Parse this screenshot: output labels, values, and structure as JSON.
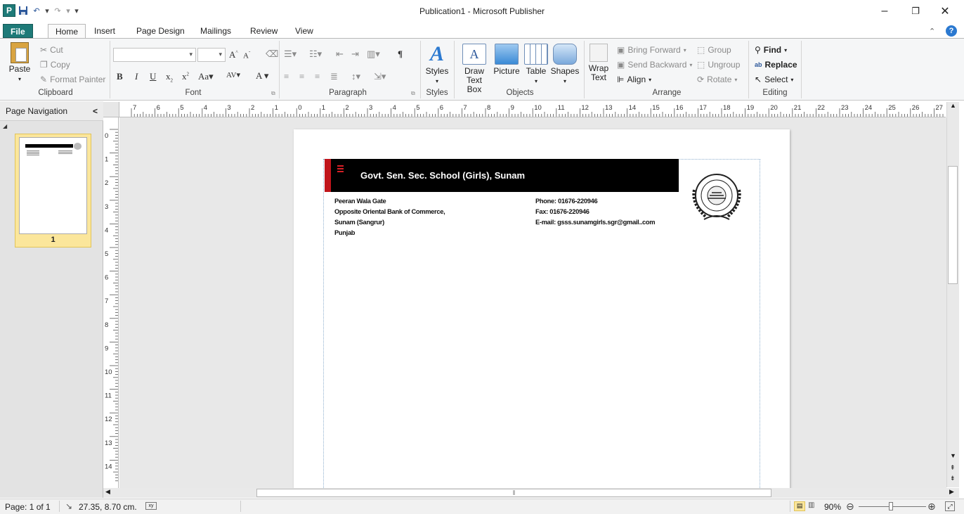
{
  "window": {
    "title": "Publication1 - Microsoft Publisher",
    "app_logo": "P",
    "minimize": "–",
    "restore": "❐",
    "close": "✕"
  },
  "qat": {
    "undo": "↶",
    "redo": "↷",
    "customize": "▾"
  },
  "tabs": [
    "File",
    "Home",
    "Insert",
    "Page Design",
    "Mailings",
    "Review",
    "View"
  ],
  "ribbon": {
    "clipboard": {
      "paste": "Paste",
      "cut": "Cut",
      "copy": "Copy",
      "format_painter": "Format Painter",
      "label": "Clipboard"
    },
    "font": {
      "label": "Font"
    },
    "paragraph": {
      "label": "Paragraph"
    },
    "styles": {
      "button": "Styles",
      "label": "Styles"
    },
    "objects": {
      "draw_text_box": "Draw Text Box",
      "picture": "Picture",
      "table": "Table",
      "shapes": "Shapes",
      "label": "Objects"
    },
    "arrange": {
      "wrap_text": "Wrap Text",
      "bring_forward": "Bring Forward",
      "send_backward": "Send Backward",
      "align": "Align",
      "group": "Group",
      "ungroup": "Ungroup",
      "rotate": "Rotate",
      "label": "Arrange"
    },
    "editing": {
      "find": "Find",
      "replace": "Replace",
      "select": "Select",
      "label": "Editing"
    }
  },
  "nav_pane": {
    "title": "Page Navigation",
    "collapse": "<",
    "page_number": "1"
  },
  "ruler": {
    "h_ticks": [
      "7",
      "6",
      "5",
      "4",
      "3",
      "2",
      "1",
      "0",
      "1",
      "2",
      "3",
      "4",
      "5",
      "6",
      "7",
      "8",
      "9",
      "10",
      "11",
      "12",
      "13",
      "14",
      "15",
      "16",
      "17",
      "18",
      "19",
      "20",
      "21",
      "22",
      "23",
      "24",
      "25",
      "26",
      "27"
    ],
    "v_ticks": [
      "0",
      "1",
      "2",
      "3",
      "4",
      "5",
      "6",
      "7",
      "8",
      "9",
      "10",
      "11",
      "12",
      "13",
      "14"
    ]
  },
  "document": {
    "banner_title": "Govt. Sen. Sec. School (Girls), Sunam",
    "address_lines": [
      "Peeran Wala Gate",
      "Opposite Oriental Bank of Commerce,",
      "Sunam (Sangrur)",
      "Punjab"
    ],
    "contact_lines": [
      "Phone: 01676-220946",
      "Fax: 01676-220946",
      "E-mail: gsss.sunamgirls.sgr@gmail..com"
    ]
  },
  "status": {
    "page": "Page: 1 of 1",
    "position": "27.35, 8.70 cm.",
    "zoom": "90%"
  },
  "colors": {
    "file_tab": "#1e7a78",
    "banner": "#000000",
    "banner_accent": "#c0151b",
    "thumb_highlight": "#fbe69b"
  }
}
